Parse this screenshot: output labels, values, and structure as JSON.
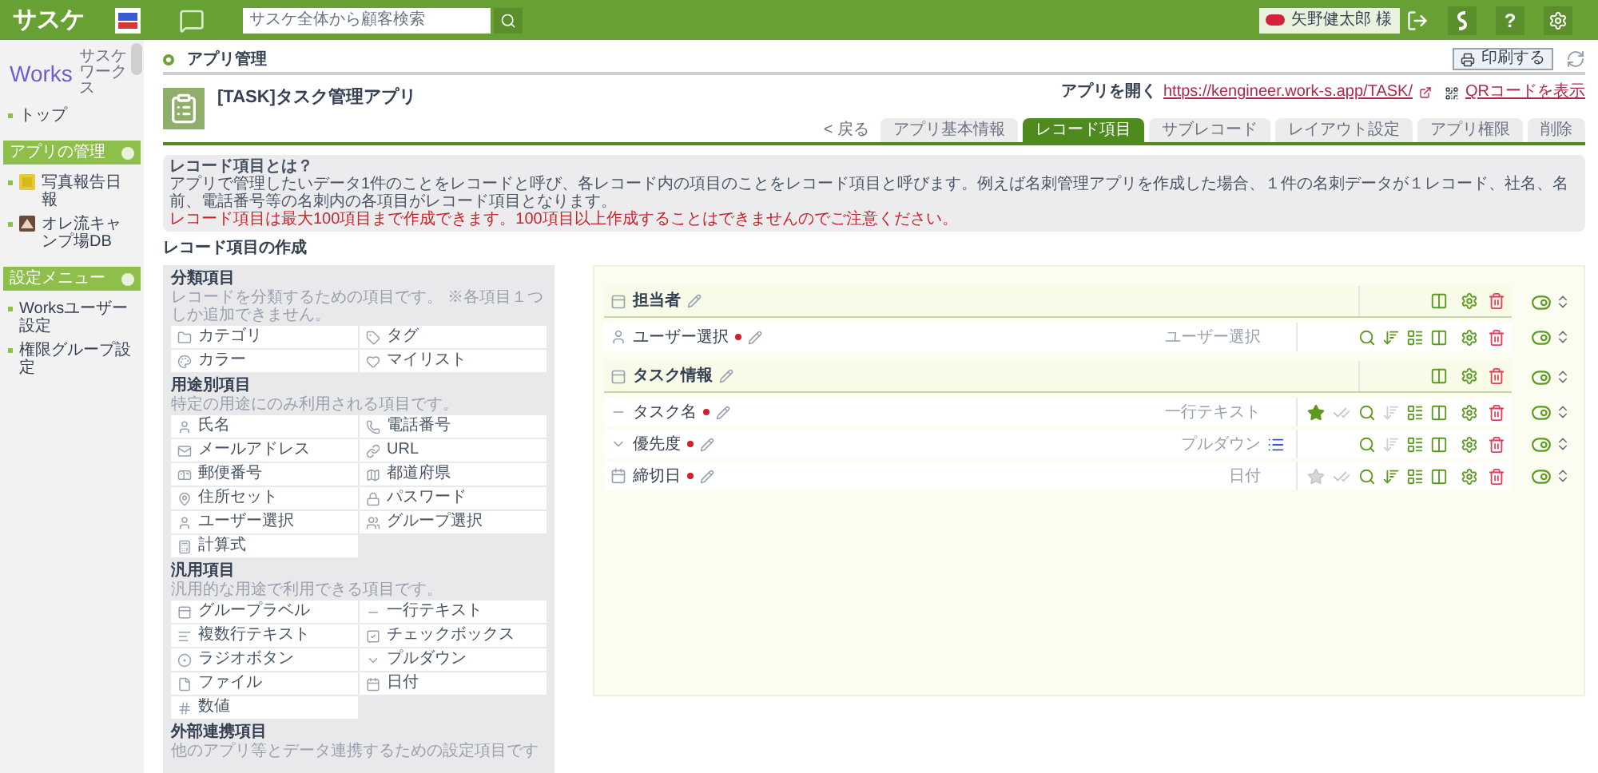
{
  "header": {
    "logo": "サスケ",
    "search": {
      "placeholder": "サスケ全体から顧客検索"
    },
    "user": "矢野健太郎 様",
    "help": "?"
  },
  "sidebar": {
    "logo": "Works",
    "logo_sub": "サスケワークス",
    "top": "トップ",
    "sections": [
      {
        "title": "アプリの管理",
        "items": [
          {
            "label": "写真報告日報",
            "kind": "photo"
          },
          {
            "label": "オレ流キャンプ場DB",
            "kind": "camp"
          }
        ]
      },
      {
        "title": "設定メニュー",
        "items": [
          {
            "label": "Worksユーザー設定"
          },
          {
            "label": "権限グループ設定"
          }
        ]
      }
    ]
  },
  "breadcrumb": "アプリ管理",
  "print_button": "印刷する",
  "app": {
    "title": "[TASK]タスク管理アプリ",
    "open_label": "アプリを開く",
    "url": "https://kengineer.work-s.app/TASK/",
    "qr_link": "QRコードを表示"
  },
  "back_link": "< 戻る",
  "tabs": [
    {
      "label": "アプリ基本情報",
      "selected": false
    },
    {
      "label": "レコード項目",
      "selected": true
    },
    {
      "label": "サブレコード",
      "selected": false
    },
    {
      "label": "レイアウト設定",
      "selected": false
    },
    {
      "label": "アプリ権限",
      "selected": false
    },
    {
      "label": "削除",
      "selected": false
    }
  ],
  "info": {
    "title": "レコード項目とは？",
    "text": "アプリで管理したいデータ1件のことをレコードと呼び、各レコード内の項目のことをレコード項目と呼びます。例えば名刺管理アプリを作成した場合、１件の名刺データが１レコード、社名、名前、電話番号等の名刺内の各項目がレコード項目となります。",
    "warning": "レコード項目は最大100項目まで作成できます。100項目以上作成することはできませんのでご注意ください。"
  },
  "section_title": "レコード項目の作成",
  "palette": [
    {
      "title": "分類項目",
      "description": "レコードを分類するための項目です。 ※各項目１つしか追加できません。",
      "items": [
        {
          "label": "カテゴリ",
          "kind": "folder"
        },
        {
          "label": "タグ",
          "kind": "tag"
        },
        {
          "label": "カラー",
          "kind": "palette"
        },
        {
          "label": "マイリスト",
          "kind": "heart"
        }
      ]
    },
    {
      "title": "用途別項目",
      "description": "特定の用途にのみ利用される項目です。",
      "items": [
        {
          "label": "氏名",
          "kind": "person"
        },
        {
          "label": "電話番号",
          "kind": "phone"
        },
        {
          "label": "メールアドレス",
          "kind": "mail"
        },
        {
          "label": "URL",
          "kind": "link"
        },
        {
          "label": "郵便番号",
          "kind": "postal"
        },
        {
          "label": "都道府県",
          "kind": "map"
        },
        {
          "label": "住所セット",
          "kind": "pin"
        },
        {
          "label": "パスワード",
          "kind": "lock"
        },
        {
          "label": "ユーザー選択",
          "kind": "user"
        },
        {
          "label": "グループ選択",
          "kind": "users"
        },
        {
          "label": "計算式",
          "kind": "calc"
        }
      ]
    },
    {
      "title": "汎用項目",
      "description": "汎用的な用途で利用できる項目です。",
      "items": [
        {
          "label": "グループラベル",
          "kind": "group"
        },
        {
          "label": "一行テキスト",
          "kind": "line"
        },
        {
          "label": "複数行テキスト",
          "kind": "text"
        },
        {
          "label": "チェックボックス",
          "kind": "check"
        },
        {
          "label": "ラジオボタン",
          "kind": "radio"
        },
        {
          "label": "プルダウン",
          "kind": "dropdown"
        },
        {
          "label": "ファイル",
          "kind": "file"
        },
        {
          "label": "日付",
          "kind": "date"
        },
        {
          "label": "数値",
          "kind": "number"
        }
      ]
    },
    {
      "title": "外部連携項目",
      "description": "他のアプリ等とデータ連携するための設定項目です"
    }
  ],
  "groups": [
    {
      "label": "担当者",
      "fields": [
        {
          "label": "ユーザー選択",
          "kind": "user",
          "required": true,
          "type": "ユーザー選択",
          "sort_enabled": true
        }
      ]
    },
    {
      "label": "タスク情報",
      "fields": [
        {
          "label": "タスク名",
          "kind": "line",
          "required": true,
          "type": "一行テキスト",
          "starred": true,
          "sort_enabled": false
        },
        {
          "label": "優先度",
          "kind": "dropdown",
          "required": true,
          "type": "プルダウン",
          "options_icon": true,
          "sort_enabled": false
        },
        {
          "label": "締切日",
          "kind": "date",
          "required": true,
          "type": "日付",
          "starred": false,
          "sort_enabled": true
        }
      ]
    }
  ]
}
